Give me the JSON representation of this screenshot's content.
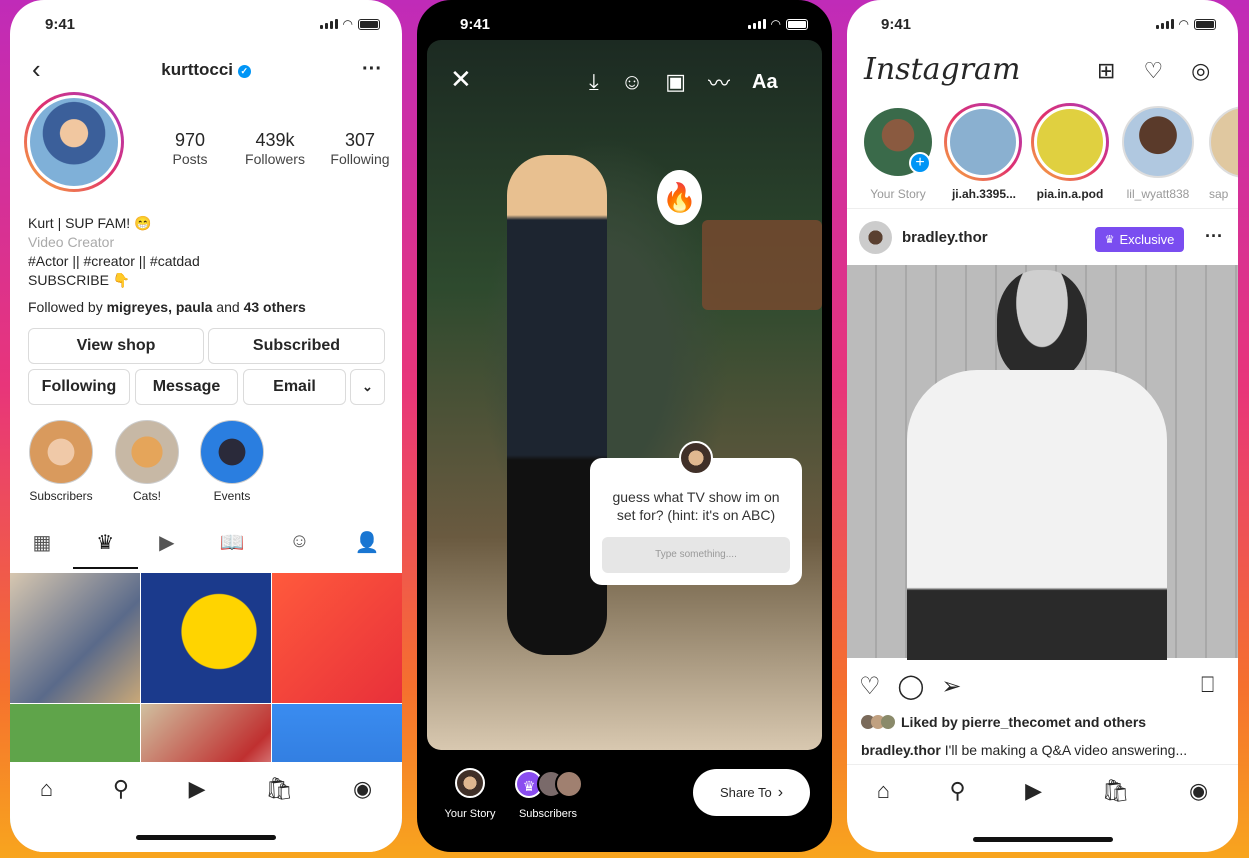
{
  "status_time": "9:41",
  "profile": {
    "username": "kurttocci",
    "stats": [
      {
        "value": "970",
        "label": "Posts"
      },
      {
        "value": "439k",
        "label": "Followers"
      },
      {
        "value": "307",
        "label": "Following"
      }
    ],
    "bio_name": "Kurt | SUP FAM! 😁",
    "bio_category": "Video Creator",
    "bio_tags": "#Actor || #creator || #catdad",
    "bio_cta": "SUBSCRIBE 👇",
    "followed_prefix": "Followed by ",
    "followed_names": "migreyes, paula",
    "followed_and": " and ",
    "followed_others": "43 others",
    "buttons": {
      "view_shop": "View shop",
      "subscribed": "Subscribed",
      "following": "Following",
      "message": "Message",
      "email": "Email"
    },
    "highlights": [
      {
        "label": "Subscribers"
      },
      {
        "label": "Cats!"
      },
      {
        "label": "Events"
      }
    ],
    "tabs": [
      "grid",
      "exclusive",
      "reels",
      "guides",
      "effects",
      "tagged"
    ]
  },
  "story": {
    "question": "guess what TV show im on set for? (hint: it's on ABC)",
    "placeholder": "Type something....",
    "text_tool": "Aa",
    "your_story": "Your Story",
    "subscribers": "Subscribers",
    "share_to": "Share To"
  },
  "feed": {
    "logo": "Instagram",
    "stories": [
      {
        "name": "Your Story"
      },
      {
        "name": "ji.ah.3395..."
      },
      {
        "name": "pia.in.a.pod"
      },
      {
        "name": "lil_wyatt838"
      },
      {
        "name": "sap"
      }
    ],
    "post_user": "bradley.thor",
    "badge": "Exclusive",
    "liked_by": "Liked by pierre_thecomet and others",
    "caption_user": "bradley.thor",
    "caption": " I'll be making a Q&A video answering..."
  },
  "colors": {
    "accent": "#0095f6",
    "exclusive": "#7a4df0",
    "text": "#262626"
  }
}
